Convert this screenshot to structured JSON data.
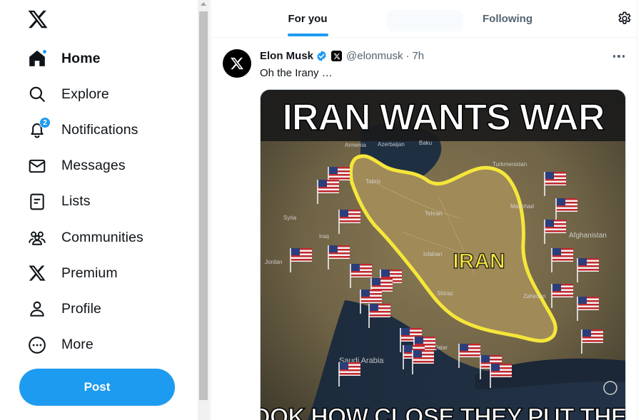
{
  "sidebar": {
    "logo_icon": "x-logo-icon",
    "items": [
      {
        "label": "Home",
        "icon": "home-icon",
        "active": true
      },
      {
        "label": "Explore",
        "icon": "search-icon"
      },
      {
        "label": "Notifications",
        "icon": "bell-icon",
        "badge": "2"
      },
      {
        "label": "Messages",
        "icon": "envelope-icon"
      },
      {
        "label": "Lists",
        "icon": "list-icon"
      },
      {
        "label": "Communities",
        "icon": "people-icon"
      },
      {
        "label": "Premium",
        "icon": "x-logo-icon"
      },
      {
        "label": "Profile",
        "icon": "person-icon"
      },
      {
        "label": "More",
        "icon": "more-circle-icon"
      }
    ],
    "post_label": "Post"
  },
  "tabs": {
    "for_you": "For you",
    "following": "Following",
    "settings_icon": "gear-icon"
  },
  "tweet": {
    "name": "Elon Musk",
    "handle": "@elonmusk",
    "separator": "·",
    "time": "7h",
    "text": "Oh the Irany …",
    "media": {
      "headline": "IRAN WANTS WAR",
      "center_label": "IRAN",
      "footer": "LOOK HOW CLOSE THEY PUT THEIR",
      "map_labels": [
        "Armenia",
        "Azerbaijan",
        "Baku",
        "Turkmenistan",
        "Tabriz",
        "Mashhad",
        "Tehran",
        "Afghanistan",
        "Syria",
        "Iraq",
        "Isfahan",
        "Shiraz",
        "Zahedan",
        "Jordan",
        "Saudi Arabia",
        "Qatar"
      ]
    }
  },
  "colors": {
    "accent": "#1d9bf0",
    "text": "#0f1419",
    "muted": "#536471",
    "iran_outline": "#f5e63a"
  }
}
